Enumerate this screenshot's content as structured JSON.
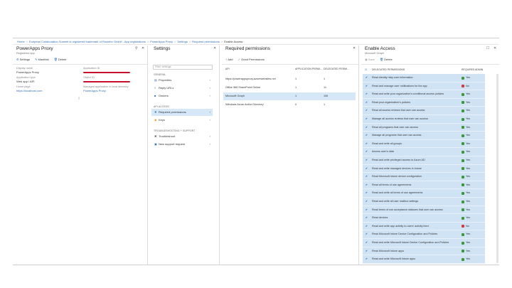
{
  "breadcrumb": {
    "items": [
      "Home",
      "Eurlpean Collaboration Summit is registered trademark of Rosinfor GmbH - App registrations",
      "PowerApps Proxy",
      "Settings",
      "Required permissions",
      "Enable Access"
    ]
  },
  "blade1": {
    "title": "PowerApps Proxy",
    "subtitle": "Registered app",
    "toolbar": [
      "Settings",
      "Manifest",
      "Delete"
    ],
    "fields": {
      "display_name_label": "Display name",
      "display_name_value": "PowerApps Proxy",
      "app_type_label": "Application type",
      "app_type_value": "Web app / API",
      "home_page_label": "Home page",
      "home_page_value": "https://localhost.com",
      "app_id_label": "Application ID",
      "object_id_label": "Object ID",
      "managed_label": "Managed application in local directory",
      "managed_value": "PowerApps Proxy"
    }
  },
  "blade2": {
    "title": "Settings",
    "search_placeholder": "Filter settings",
    "sections": {
      "general": "GENERAL",
      "api_access": "API ACCESS",
      "troubleshooting": "TROUBLESHOOTING + SUPPORT"
    },
    "items": {
      "properties": "Properties",
      "reply_urls": "Reply URLs",
      "owners": "Owners",
      "required_permissions": "Required permissions",
      "keys": "Keys",
      "troubleshoot": "Troubleshoot",
      "new_support": "New support request"
    }
  },
  "blade3": {
    "title": "Required permissions",
    "toolbar": [
      "Add",
      "Grant Permissions"
    ],
    "columns": [
      "API",
      "APPLICATION PERMI...",
      "DELEGATED PERMI..."
    ],
    "rows": [
      {
        "api": "https://powerappsproxy.azurewebsites.net",
        "app": "1",
        "del": "1"
      },
      {
        "api": "Office 365 SharePoint Online",
        "app": "1",
        "del": "11"
      },
      {
        "api": "Microsoft Graph",
        "app": "1",
        "del": "106"
      },
      {
        "api": "Windows Azure Active Directory",
        "app": "0",
        "del": "1"
      }
    ]
  },
  "blade4": {
    "title": "Enable Access",
    "subtitle": "Microsoft Graph",
    "toolbar": [
      "Save",
      "Delete"
    ],
    "col_permissions": "DELEGATED PERMISSIONS",
    "col_required": "REQUIRES ADMIN",
    "colors": {
      "yes": "#3a9a3a",
      "no": "#d23b3b"
    },
    "rows": [
      {
        "name": "Read identity risky user information",
        "admin": "Yes",
        "flag": "yes"
      },
      {
        "name": "Read and manage user notifications for the app",
        "admin": "No",
        "flag": "no"
      },
      {
        "name": "Read and write your organization's conditional access policies",
        "admin": "Yes",
        "flag": "yes"
      },
      {
        "name": "Read your organization's policies",
        "admin": "Yes",
        "flag": "yes"
      },
      {
        "name": "Read all access reviews that user can access",
        "admin": "Yes",
        "flag": "yes"
      },
      {
        "name": "Manage all access reviews that user can access",
        "admin": "Yes",
        "flag": "yes"
      },
      {
        "name": "Read all programs that user can access",
        "admin": "Yes",
        "flag": "yes"
      },
      {
        "name": "Manage all programs that user can access",
        "admin": "Yes",
        "flag": "yes"
      },
      {
        "name": "Read and write all groups",
        "admin": "Yes",
        "flag": "yes"
      },
      {
        "name": "Access user's data",
        "admin": "Yes",
        "flag": "yes"
      },
      {
        "name": "Read and write privileged access to Azure AD",
        "admin": "Yes",
        "flag": "yes"
      },
      {
        "name": "Read and write managed devices in Intune",
        "admin": "Yes",
        "flag": "yes"
      },
      {
        "name": "Read Microsoft Intune device configuration",
        "admin": "Yes",
        "flag": "yes"
      },
      {
        "name": "Read all terms of use agreements",
        "admin": "Yes",
        "flag": "yes"
      },
      {
        "name": "Read and write all terms of use agreements",
        "admin": "Yes",
        "flag": "yes"
      },
      {
        "name": "Read and write all user mailbox settings",
        "admin": "Yes",
        "flag": "yes"
      },
      {
        "name": "Read terms of use acceptance statuses that user can access",
        "admin": "Yes",
        "flag": "yes"
      },
      {
        "name": "Read devices",
        "admin": "Yes",
        "flag": "yes"
      },
      {
        "name": "Read and write app activity to users' activity feed",
        "admin": "No",
        "flag": "no"
      },
      {
        "name": "Read Microsoft Intune Device Configuration and Policies",
        "admin": "Yes",
        "flag": "yes"
      },
      {
        "name": "Read and write Microsoft Intune Device Configuration and Policies",
        "admin": "Yes",
        "flag": "yes"
      },
      {
        "name": "Read Microsoft Intune apps",
        "admin": "Yes",
        "flag": "yes"
      },
      {
        "name": "Read and write Microsoft Intune apps",
        "admin": "Yes",
        "flag": "yes"
      }
    ]
  }
}
